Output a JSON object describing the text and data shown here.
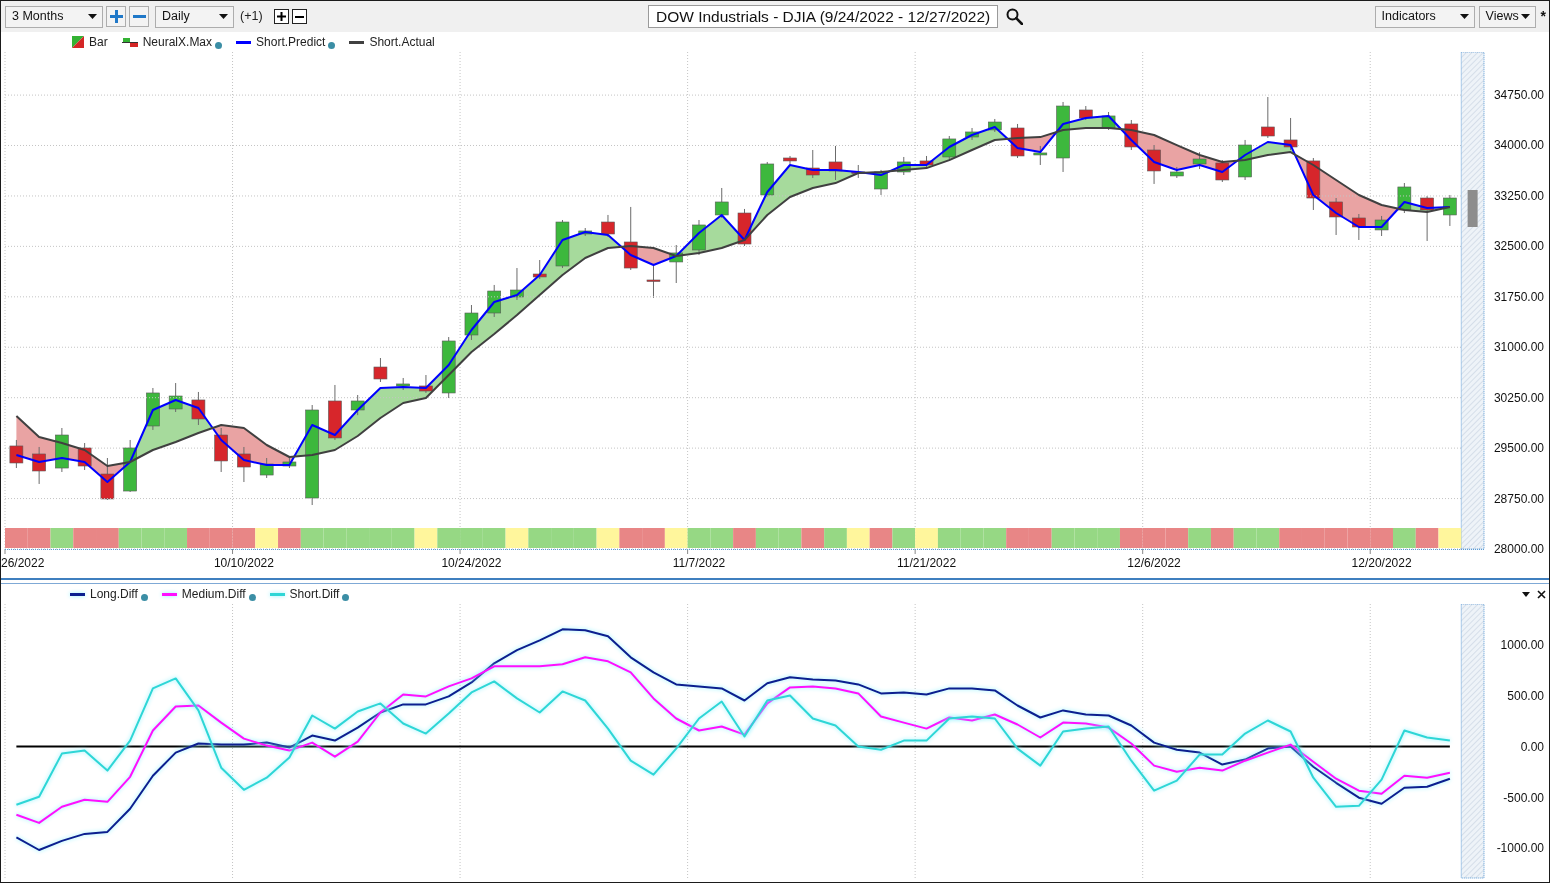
{
  "toolbar": {
    "period": "3 Months",
    "interval": "Daily",
    "step": "(+1)",
    "title": "DOW Industrials - DJIA (9/24/2022 - 12/27/2022)",
    "indicators": "Indicators",
    "views": "Views",
    "modified_mark": "*"
  },
  "price_panel": {
    "legend": [
      {
        "label": "Bar",
        "kind": "candle",
        "dot": false
      },
      {
        "label": "NeuralX.Max",
        "kind": "signal",
        "dot": true
      },
      {
        "kind": "line",
        "dot": true
      },
      {
        "kind": "line",
        "dot": false
      }
    ],
    "chart_data": {
      "type": "candlestick",
      "grid": true,
      "categories": [
        "26/2022",
        null,
        null,
        null,
        null,
        null,
        null,
        null,
        null,
        null,
        "10/10/2022",
        null,
        null,
        null,
        null,
        null,
        null,
        null,
        null,
        null,
        "10/24/2022",
        null,
        null,
        null,
        null,
        null,
        null,
        null,
        null,
        null,
        "11/7/2022",
        null,
        null,
        null,
        null,
        null,
        null,
        null,
        null,
        null,
        "11/21/2022",
        null,
        null,
        null,
        null,
        null,
        null,
        null,
        null,
        null,
        "12/6/2022",
        null,
        null,
        null,
        null,
        null,
        null,
        null,
        null,
        null,
        "12/20/2022",
        null,
        null,
        null,
        null
      ],
      "ylim": [
        28000,
        35390
      ],
      "yticks": [
        {
          "value": 28000,
          "label": "28000.00"
        },
        {
          "value": 29500,
          "label": "29500.00"
        },
        {
          "value": 31000,
          "label": "31000.00"
        },
        {
          "value": 32500,
          "label": "32500.00"
        },
        {
          "value": 34000,
          "label": "34000.00"
        }
      ],
      "ohlc": [
        [
          29532,
          29621,
          29204,
          29279
        ],
        [
          29413,
          29517,
          28967,
          29160
        ],
        [
          29204,
          29799,
          29145,
          29695
        ],
        [
          29502,
          29576,
          29175,
          29234
        ],
        [
          29115,
          29353,
          28729,
          28744
        ],
        [
          28862,
          29621,
          28848,
          29502
        ],
        [
          29829,
          30394,
          29770,
          30320
        ],
        [
          30082,
          30468,
          30037,
          30275
        ],
        [
          30216,
          30335,
          29844,
          29933
        ],
        [
          29695,
          29799,
          29145,
          29309
        ],
        [
          29413,
          29517,
          28996,
          29219
        ],
        [
          29100,
          29353,
          29056,
          29264
        ],
        [
          29234,
          29383,
          29204,
          29294
        ],
        [
          28758,
          30141,
          28654,
          30067
        ],
        [
          30201,
          30439,
          29621,
          29651
        ],
        [
          30067,
          30290,
          29990,
          30201
        ],
        [
          30706,
          30840,
          30483,
          30528
        ],
        [
          30424,
          30543,
          30364,
          30454
        ],
        [
          30424,
          30587,
          30320,
          30349
        ],
        [
          30320,
          31152,
          30245,
          31093
        ],
        [
          31182,
          31628,
          31108,
          31509
        ],
        [
          31509,
          31926,
          31450,
          31836
        ],
        [
          31747,
          32178,
          31703,
          31851
        ],
        [
          32089,
          32297,
          32015,
          32045
        ],
        [
          32208,
          32892,
          32178,
          32862
        ],
        [
          32684,
          32773,
          32654,
          32729
        ],
        [
          32862,
          32967,
          32639,
          32684
        ],
        [
          32565,
          33086,
          32149,
          32178
        ],
        [
          32000,
          32238,
          31732,
          31985
        ],
        [
          32268,
          32520,
          31955,
          32402
        ],
        [
          32446,
          32892,
          32372,
          32818
        ],
        [
          32967,
          33368,
          32922,
          33160
        ],
        [
          32996,
          33056,
          32506,
          32535
        ],
        [
          33264,
          33755,
          33234,
          33725
        ],
        [
          33814,
          33844,
          33725,
          33770
        ],
        [
          33665,
          33933,
          33517,
          33561
        ],
        [
          33755,
          33993,
          33487,
          33621
        ],
        [
          33606,
          33710,
          33517,
          33591
        ],
        [
          33353,
          33636,
          33264,
          33606
        ],
        [
          33606,
          33829,
          33561,
          33755
        ],
        [
          33770,
          33844,
          33665,
          33710
        ],
        [
          33829,
          34141,
          33784,
          34097
        ],
        [
          34126,
          34260,
          34082,
          34201
        ],
        [
          34231,
          34394,
          34201,
          34349
        ],
        [
          34260,
          34320,
          33814,
          33844
        ],
        [
          33859,
          33993,
          33710,
          33889
        ],
        [
          33814,
          34647,
          33606,
          34587
        ],
        [
          34528,
          34587,
          34379,
          34409
        ],
        [
          34260,
          34498,
          34231,
          34439
        ],
        [
          34320,
          34379,
          33933,
          33978
        ],
        [
          33933,
          34007,
          33428,
          33621
        ],
        [
          33547,
          33680,
          33517,
          33606
        ],
        [
          33725,
          33900,
          33650,
          33799
        ],
        [
          33740,
          33784,
          33457,
          33487
        ],
        [
          33532,
          34082,
          33487,
          34007
        ],
        [
          34275,
          34721,
          34112,
          34141
        ],
        [
          34082,
          34409,
          33933,
          33978
        ],
        [
          33770,
          33814,
          33041,
          33219
        ],
        [
          33160,
          33219,
          32669,
          32937
        ],
        [
          32922,
          32981,
          32595,
          32788
        ],
        [
          32744,
          32952,
          32654,
          32892
        ],
        [
          33041,
          33442,
          32996,
          33383
        ],
        [
          33219,
          33249,
          32580,
          33041
        ],
        [
          32967,
          33264,
          32803,
          33219
        ],
        null
      ]
    },
    "overlay": {
      "chart_data": {
        "type": "line",
        "grid": true,
        "ylim": [
          28000,
          34750
        ],
        "yticks": [
          {
            "value": 28750,
            "label": "28750.00"
          },
          {
            "value": 30250,
            "label": "30250.00"
          },
          {
            "value": 31750,
            "label": "31750.00"
          },
          {
            "value": 33250,
            "label": "33250.00"
          },
          {
            "value": 34750,
            "label": "34750.00"
          }
        ],
        "series": [
          {
            "name": "Short.Predict",
            "color": "#0000ff",
            "values": [
              29398,
              29294,
              29353,
              29294,
              28996,
              29294,
              30067,
              30216,
              30097,
              29621,
              29323,
              29249,
              29249,
              29844,
              29695,
              30067,
              30394,
              30409,
              30394,
              30736,
              31257,
              31673,
              31777,
              32074,
              32595,
              32714,
              32669,
              32372,
              32223,
              32357,
              32699,
              32967,
              32595,
              33309,
              33710,
              33636,
              33636,
              33606,
              33561,
              33710,
              33710,
              33978,
              34156,
              34275,
              33963,
              33903,
              34320,
              34409,
              34439,
              34082,
              33755,
              33636,
              33710,
              33606,
              33859,
              34052,
              34007,
              33264,
              32996,
              32788,
              32788,
              33160,
              33071,
              33086
            ]
          },
          {
            "name": "Short.Actual",
            "color": "#404040",
            "values": [
              29978,
              29665,
              29576,
              29472,
              29234,
              29294,
              29472,
              29591,
              29725,
              29844,
              29799,
              29546,
              29368,
              29398,
              29472,
              29680,
              29948,
              30171,
              30245,
              30587,
              30929,
              31197,
              31480,
              31777,
              32074,
              32327,
              32476,
              32506,
              32476,
              32357,
              32402,
              32476,
              32595,
              32967,
              33234,
              33368,
              33442,
              33591,
              33606,
              33636,
              33665,
              33784,
              33933,
              34082,
              34112,
              34126,
              34231,
              34260,
              34260,
              34231,
              34156,
              34007,
              33859,
              33755,
              33784,
              33859,
              33903,
              33710,
              33487,
              33264,
              33115,
              33041,
              33011,
              33086
            ]
          }
        ]
      }
    },
    "signal_bar": [
      {
        "color": "#e88686"
      },
      {
        "color": "#e88686"
      },
      {
        "color": "#96d884"
      },
      {
        "color": "#e88686"
      },
      {
        "color": "#e88686"
      },
      {
        "color": "#96d884"
      },
      {
        "color": "#96d884"
      },
      {
        "color": "#96d884"
      },
      {
        "color": "#e88686"
      },
      {
        "color": "#e88686"
      },
      {
        "color": "#e88686"
      },
      {
        "color": "#fff69c"
      },
      {
        "color": "#e88686"
      },
      {
        "color": "#96d884"
      },
      {
        "color": "#96d884"
      },
      {
        "color": "#96d884"
      },
      {
        "color": "#96d884"
      },
      {
        "color": "#96d884"
      },
      {
        "color": "#fff69c"
      },
      {
        "color": "#96d884"
      },
      {
        "color": "#96d884"
      },
      {
        "color": "#96d884"
      },
      {
        "color": "#fff69c"
      },
      {
        "color": "#96d884"
      },
      {
        "color": "#96d884"
      },
      {
        "color": "#96d884"
      },
      {
        "color": "#fff69c"
      },
      {
        "color": "#e88686"
      },
      {
        "color": "#e88686"
      },
      {
        "color": "#fff69c"
      },
      {
        "color": "#96d884"
      },
      {
        "color": "#96d884"
      },
      {
        "color": "#e88686"
      },
      {
        "color": "#96d884"
      },
      {
        "color": "#96d884"
      },
      {
        "color": "#e88686"
      },
      {
        "color": "#96d884"
      },
      {
        "color": "#fff69c"
      },
      {
        "color": "#e88686"
      },
      {
        "color": "#96d884"
      },
      {
        "color": "#fff69c"
      },
      {
        "color": "#96d884"
      },
      {
        "color": "#96d884"
      },
      {
        "color": "#96d884"
      },
      {
        "color": "#e88686"
      },
      {
        "color": "#e88686"
      },
      {
        "color": "#96d884"
      },
      {
        "color": "#96d884"
      },
      {
        "color": "#96d884"
      },
      {
        "color": "#e88686"
      },
      {
        "color": "#e88686"
      },
      {
        "color": "#e88686"
      },
      {
        "color": "#96d884"
      },
      {
        "color": "#e88686"
      },
      {
        "color": "#96d884"
      },
      {
        "color": "#96d884"
      },
      {
        "color": "#e88686"
      },
      {
        "color": "#e88686"
      },
      {
        "color": "#e88686"
      },
      {
        "color": "#e88686"
      },
      {
        "color": "#e88686"
      },
      {
        "color": "#96d884"
      },
      {
        "color": "#e88686"
      },
      {
        "color": "#fff69c"
      }
    ]
  },
  "indicator_panel": {
    "legend": [
      {
        "kind": "line",
        "dot": true
      },
      {
        "kind": "line",
        "dot": true
      },
      {
        "kind": "line",
        "dot": true
      }
    ],
    "chart_data": {
      "type": "line",
      "grid": true,
      "ylim": [
        -1290,
        1400
      ],
      "yticks": [
        {
          "value": -1000,
          "label": "-1000.00"
        },
        {
          "value": -500,
          "label": "-500.00"
        },
        {
          "value": 0,
          "label": "0.00"
        },
        {
          "value": 500,
          "label": "500.00"
        },
        {
          "value": 1000,
          "label": "1000.00"
        }
      ],
      "series": [
        {
          "name": "Long.Diff",
          "color": "#0c1f8f",
          "values": [
            -890,
            -1015,
            -926,
            -857,
            -837,
            -611,
            -286,
            -59,
            30,
            20,
            20,
            39,
            -10,
            108,
            59,
            187,
            335,
            414,
            414,
            493,
            630,
            818,
            946,
            1044,
            1152,
            1143,
            1084,
            877,
            729,
            611,
            591,
            571,
            453,
            621,
            680,
            660,
            650,
            611,
            522,
            532,
            512,
            571,
            571,
            552,
            404,
            286,
            355,
            315,
            305,
            207,
            39,
            -30,
            -59,
            -177,
            -128,
            -20,
            0,
            -197,
            -355,
            -502,
            -561,
            -404,
            -394,
            -315
          ]
        },
        {
          "name": "Medium.Diff",
          "color": "#ff10ff",
          "values": [
            -670,
            -749,
            -591,
            -522,
            -542,
            -296,
            158,
            394,
            404,
            236,
            79,
            10,
            -39,
            39,
            -99,
            49,
            335,
            512,
            493,
            591,
            670,
            788,
            788,
            788,
            808,
            877,
            837,
            729,
            473,
            276,
            158,
            197,
            118,
            424,
            581,
            591,
            571,
            522,
            296,
            236,
            177,
            286,
            256,
            315,
            217,
            89,
            236,
            227,
            187,
            30,
            -187,
            -246,
            -207,
            -236,
            -138,
            -59,
            20,
            -148,
            -315,
            -433,
            -463,
            -286,
            -305,
            -256
          ]
        },
        {
          "name": "Short.Diff",
          "color": "#2ed6d6",
          "values": [
            -571,
            -493,
            -69,
            -39,
            -236,
            59,
            571,
            670,
            355,
            -207,
            -424,
            -305,
            -108,
            305,
            177,
            345,
            424,
            227,
            128,
            325,
            532,
            640,
            473,
            335,
            542,
            453,
            177,
            -138,
            -276,
            -20,
            276,
            443,
            99,
            453,
            502,
            276,
            207,
            0,
            -30,
            59,
            59,
            276,
            296,
            276,
            -20,
            -187,
            148,
            177,
            197,
            -138,
            -433,
            -335,
            -79,
            -79,
            128,
            256,
            148,
            -305,
            -591,
            -581,
            -325,
            158,
            89,
            59
          ]
        }
      ]
    }
  }
}
